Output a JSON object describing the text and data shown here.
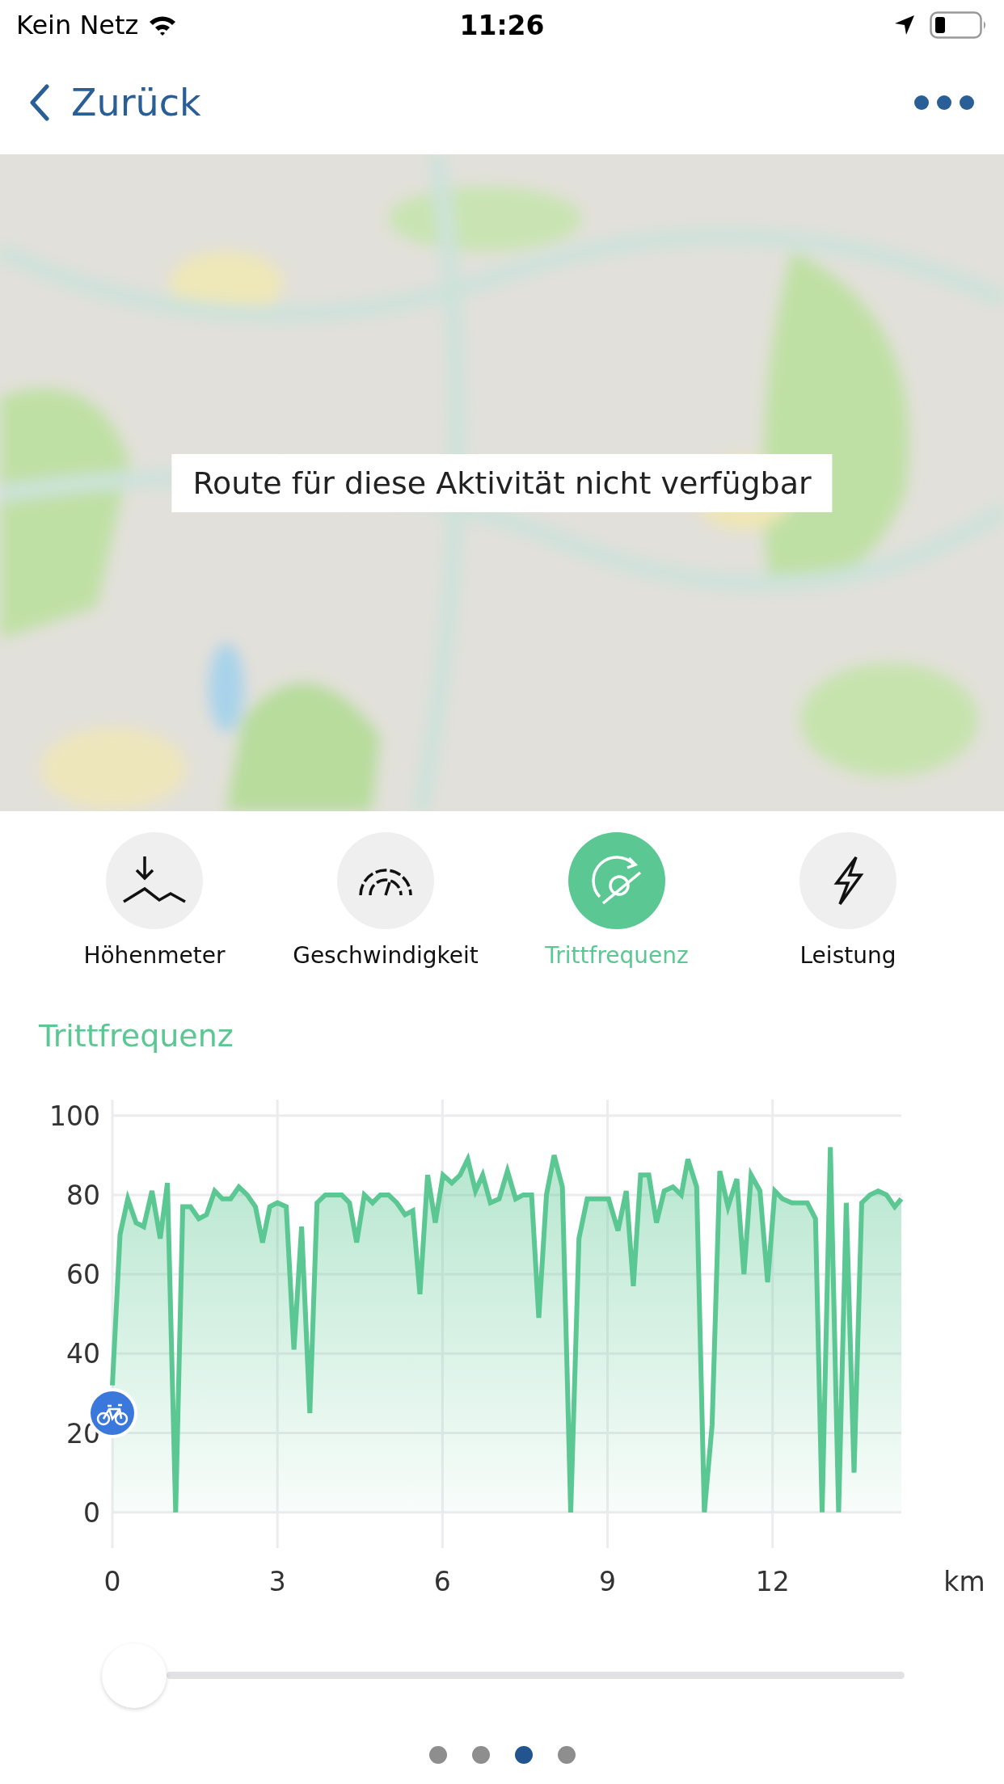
{
  "status_bar": {
    "carrier": "Kein Netz",
    "time": "11:26"
  },
  "nav": {
    "back_label": "Zurück"
  },
  "map": {
    "kind": "picture",
    "message": "Route für diese Aktivität nicht verfügbar"
  },
  "metric_tabs": [
    {
      "label": "Höhenmeter",
      "selected": false
    },
    {
      "label": "Geschwindigkeit",
      "selected": false
    },
    {
      "label": "Trittfrequenz",
      "selected": true
    },
    {
      "label": "Leistung",
      "selected": false
    }
  ],
  "chart": {
    "chart_data": {
      "type": "area",
      "grid": true,
      "title": "Trittfrequenz",
      "xlabel": "km",
      "xlim": [
        0,
        14.34
      ],
      "ylim": [
        -9,
        104
      ],
      "xticks": [
        0,
        3,
        6,
        9,
        12
      ],
      "yticks": [
        0,
        20,
        40,
        60,
        80,
        100
      ],
      "x": [
        0,
        0.14,
        0.28,
        0.43,
        0.57,
        0.72,
        0.87,
        1.0,
        1.15,
        1.28,
        1.42,
        1.57,
        1.71,
        1.86,
        2.0,
        2.15,
        2.3,
        2.45,
        2.6,
        2.73,
        2.86,
        3.0,
        3.16,
        3.3,
        3.44,
        3.59,
        3.72,
        3.87,
        4.17,
        4.31,
        4.44,
        4.58,
        4.73,
        4.87,
        5.02,
        5.17,
        5.32,
        5.46,
        5.59,
        5.73,
        5.87,
        6.01,
        6.17,
        6.32,
        6.46,
        6.6,
        6.73,
        6.87,
        7.03,
        7.18,
        7.33,
        7.47,
        7.62,
        7.75,
        7.89,
        8.03,
        8.18,
        8.33,
        8.48,
        8.63,
        9.02,
        9.19,
        9.34,
        9.47,
        9.6,
        9.75,
        9.89,
        10.03,
        10.19,
        10.34,
        10.46,
        10.62,
        10.76,
        10.9,
        11.04,
        11.19,
        11.35,
        11.48,
        11.61,
        11.77,
        11.91,
        12.04,
        12.18,
        12.35,
        12.63,
        12.78,
        12.9,
        13.05,
        13.2,
        13.34,
        13.48,
        13.62,
        13.77,
        13.92,
        14.07,
        14.22,
        14.34
      ],
      "series": [
        {
          "color": "#5bc792",
          "values": [
            32,
            70,
            79,
            73,
            72,
            81,
            69,
            83,
            0,
            77,
            77,
            74,
            75,
            81,
            79,
            79,
            82,
            80,
            77,
            68,
            77,
            78,
            77,
            41,
            72,
            25,
            78,
            80,
            80,
            78,
            68,
            80,
            78,
            80,
            80,
            78,
            75,
            76,
            55,
            85,
            73,
            85,
            83,
            85,
            89,
            81,
            85,
            78,
            79,
            86,
            79,
            80,
            80,
            49,
            80,
            90,
            82,
            0,
            69,
            79,
            79,
            71,
            81,
            57,
            85,
            85,
            73,
            81,
            82,
            80,
            89,
            82,
            0,
            22,
            86,
            77,
            84,
            60,
            85,
            81,
            58,
            81,
            79,
            78,
            78,
            74,
            0,
            92,
            0,
            78,
            10,
            78,
            80,
            81,
            80,
            77,
            79
          ]
        }
      ]
    }
  },
  "slider": {
    "level": 0
  },
  "page_dots": [
    {
      "selected": false
    },
    {
      "selected": false
    },
    {
      "selected": true
    },
    {
      "selected": false
    }
  ]
}
